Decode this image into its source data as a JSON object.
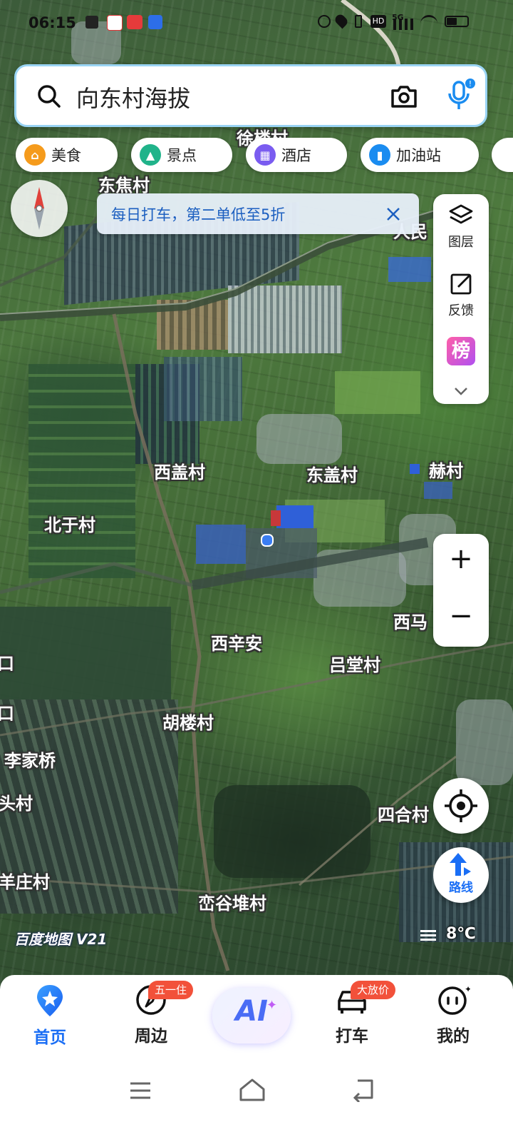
{
  "status_bar": {
    "time": "06:15",
    "network": "5G"
  },
  "search": {
    "query": "向东村海拔"
  },
  "categories": [
    {
      "label": "美食",
      "color": "#f59b1c"
    },
    {
      "label": "景点",
      "color": "#20b38a"
    },
    {
      "label": "酒店",
      "color": "#7a5cf0"
    },
    {
      "label": "加油站",
      "color": "#1a8cf0"
    }
  ],
  "promo": {
    "text": "每日打车，第二单低至5折"
  },
  "side_panel": {
    "layers_label": "图层",
    "feedback_label": "反馈",
    "rank_label": "榜"
  },
  "map_labels": [
    "徐楼村",
    "东焦村",
    "人民",
    "西盖村",
    "东盖村",
    "赫村",
    "北于村",
    "西马",
    "西辛安",
    "吕堂村",
    "胡楼村",
    "李家桥",
    "头村",
    "四合村",
    "羊庄村",
    "峦谷堆村",
    "口",
    "口"
  ],
  "zoom": {
    "in": "+",
    "out": "−"
  },
  "route": {
    "label": "路线"
  },
  "watermark": "百度地图 V21",
  "weather": {
    "temperature": "8℃"
  },
  "bottom_nav": [
    {
      "label": "首页",
      "icon": "home-location-icon",
      "active": true
    },
    {
      "label": "周边",
      "icon": "compass-icon",
      "badge": "五一住"
    },
    {
      "label": "AI",
      "icon": "ai-icon"
    },
    {
      "label": "打车",
      "icon": "car-icon",
      "badge": "大放价"
    },
    {
      "label": "我的",
      "icon": "profile-face-icon"
    }
  ],
  "colors": {
    "accent": "#1a6ef5",
    "badge": "#f2513a"
  }
}
